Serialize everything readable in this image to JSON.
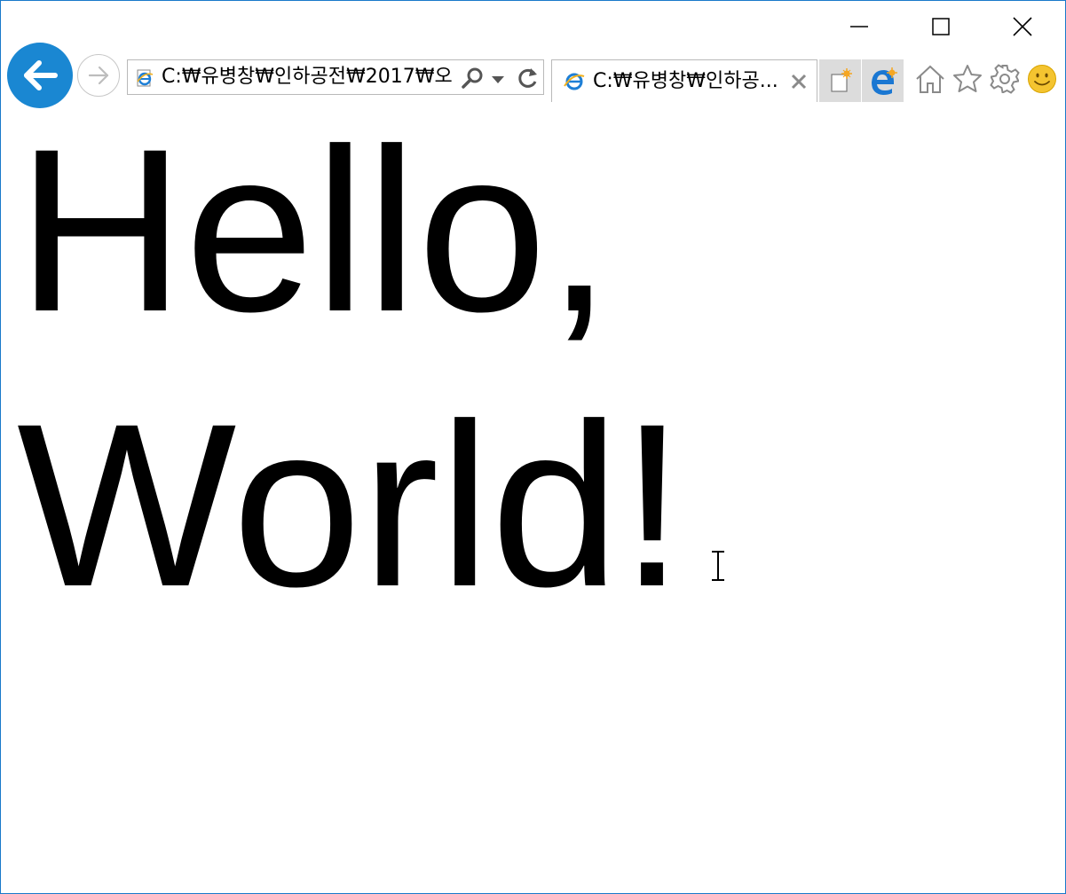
{
  "window": {
    "controls": [
      "minimize-icon",
      "maximize-icon",
      "close-icon"
    ]
  },
  "navigation": {
    "address": "C:₩유병창₩인하공전₩2017₩오",
    "tab_title": "C:₩유병창₩인하공..."
  },
  "content": {
    "line1": "Hello,",
    "line2": "World!"
  },
  "colors": {
    "accent": "#1a87d2",
    "window_border": "#1979ca",
    "tab_strip": "#dcdcdc",
    "feedback_face": "#f4c430"
  }
}
